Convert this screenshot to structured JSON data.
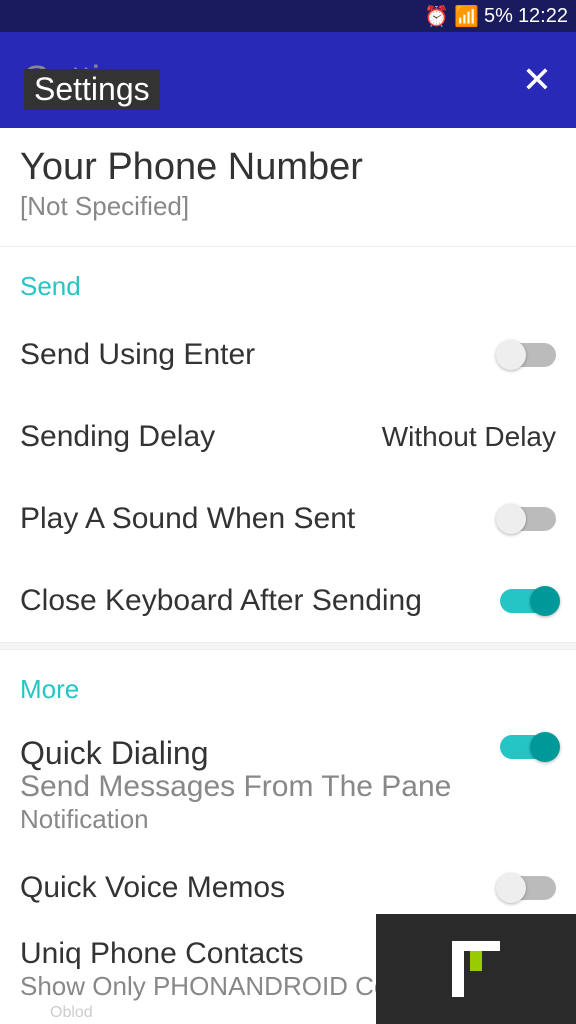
{
  "statusBar": {
    "battery": "5%",
    "time": "12:22"
  },
  "header": {
    "title": "Settings",
    "overlayTitle": "Settings"
  },
  "phoneNumber": {
    "title": "Your Phone Number",
    "value": "[Not Specified]"
  },
  "sections": {
    "send": {
      "label": "Send",
      "sendUsingEnter": {
        "label": "Send Using Enter",
        "enabled": false
      },
      "sendingDelay": {
        "label": "Sending Delay",
        "value": "Without Delay"
      },
      "playSound": {
        "label": "Play A Sound When Sent",
        "enabled": false
      },
      "closeKeyboard": {
        "label": "Close Keyboard After Sending",
        "enabled": true
      }
    },
    "more": {
      "label": "More",
      "quickDialing": {
        "label": "Quick Dialing",
        "subLabel": "Send Messages From The Pane",
        "subLabel2": "Notification",
        "enabled": true
      },
      "quickVoiceMemos": {
        "label": "Quick Voice Memos",
        "enabled": false
      },
      "uniqContacts": {
        "label": "Uniq Phone Contacts",
        "subLabel": "Show Only PHONANDROID Contacts"
      }
    }
  },
  "watermark": "Oblod"
}
